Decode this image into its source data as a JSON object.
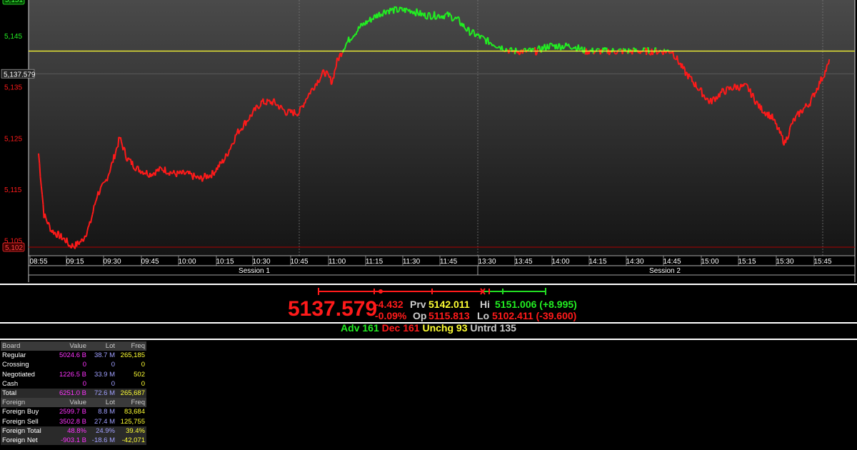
{
  "chart_data": {
    "type": "line",
    "title": "",
    "xlabel": "",
    "ylabel": "",
    "x_tick_labels": [
      "08:55",
      "09:15",
      "09:30",
      "09:45",
      "10:00",
      "10:15",
      "10:30",
      "10:45",
      "11:00",
      "11:15",
      "11:30",
      "11:45",
      "13:30",
      "13:45",
      "14:00",
      "14:15",
      "14:30",
      "14:45",
      "15:00",
      "15:15",
      "15:30",
      "15:45"
    ],
    "y_tick_labels": [
      "5,145",
      "5,135",
      "5,125",
      "5,115",
      "5,105"
    ],
    "ylim": [
      5102,
      5152
    ],
    "sessions": [
      "Session 1",
      "Session 2"
    ],
    "reference_line": 5142.011,
    "current_value_label": "5,137.579",
    "low_value_label": "5,102",
    "top_value_label": "5,151",
    "series": [
      {
        "x": [
          "08:55",
          "08:58",
          "09:02",
          "09:06",
          "09:10",
          "09:12",
          "09:15",
          "09:18",
          "09:21",
          "09:24",
          "09:27",
          "09:30",
          "09:33",
          "09:36",
          "09:40",
          "09:45",
          "09:50",
          "09:55",
          "10:00",
          "10:05",
          "10:10",
          "10:15",
          "10:20",
          "10:25",
          "10:30",
          "10:35",
          "10:40",
          "10:45",
          "10:48",
          "10:52",
          "10:55",
          "10:58",
          "11:00",
          "11:03",
          "11:06",
          "11:10",
          "11:13",
          "11:16",
          "11:20",
          "11:25",
          "11:30",
          "11:35",
          "11:40",
          "11:45",
          "11:50",
          "11:55",
          "13:30",
          "13:35",
          "13:40",
          "13:45",
          "13:50",
          "13:55",
          "14:00",
          "14:05",
          "14:10",
          "14:15",
          "14:20",
          "14:25",
          "14:30",
          "14:35",
          "14:40",
          "14:45",
          "14:50",
          "14:55",
          "15:00",
          "15:05",
          "15:10",
          "15:15",
          "15:20",
          "15:25",
          "15:28",
          "15:30",
          "15:33",
          "15:36",
          "15:40",
          "15:43",
          "15:46",
          "15:48"
        ],
        "values": [
          5122,
          5110,
          5107,
          5106,
          5105,
          5104,
          5104,
          5105,
          5108,
          5114,
          5116,
          5120,
          5125,
          5121,
          5119,
          5118,
          5119,
          5118,
          5118,
          5117,
          5118,
          5121,
          5126,
          5129,
          5132,
          5132,
          5130,
          5130,
          5133,
          5136,
          5138,
          5136,
          5140,
          5143,
          5145,
          5147,
          5148,
          5149,
          5150,
          5150,
          5150,
          5149,
          5149,
          5149,
          5148,
          5146,
          5144,
          5143,
          5142,
          5142,
          5142,
          5143,
          5143,
          5143,
          5142,
          5142,
          5142,
          5142,
          5142,
          5142,
          5142,
          5142,
          5138,
          5135,
          5132,
          5134,
          5135,
          5135,
          5131,
          5129,
          5126,
          5124,
          5128,
          5130,
          5132,
          5135,
          5138,
          5140
        ]
      }
    ]
  },
  "summary": {
    "range_bar_colors": {
      "down": "#ff1a1a",
      "up": "#22dd22"
    },
    "last": "5137.579",
    "change": "-4.432",
    "change_pct": "-0.09%",
    "prv_label": "Prv",
    "prv": "5142.011",
    "op_label": "Op",
    "op": "5115.813",
    "hi_label": "Hi",
    "hi": "5151.006 (+8.995)",
    "lo_label": "Lo",
    "lo": "5102.411 (-39.600)"
  },
  "breadth": {
    "adv": "Adv 161",
    "dec": "Dec 161",
    "unchg": "Unchg 93",
    "untrd": "Untrd 135"
  },
  "board": {
    "header": [
      "Board",
      "Value",
      "Lot",
      "Freq"
    ],
    "rows": [
      [
        "Regular",
        "5024.6 B",
        "38.7 M",
        "265,185"
      ],
      [
        "Crossing",
        "0",
        "0",
        "0"
      ],
      [
        "Negotiated",
        "1226.5 B",
        "33.9 M",
        "502"
      ],
      [
        "Cash",
        "0",
        "0",
        "0"
      ]
    ],
    "total": [
      "Total",
      "6251.0 B",
      "72.6 M",
      "265,687"
    ],
    "foreign_header": [
      "Foreign",
      "Value",
      "Lot",
      "Freq"
    ],
    "foreign_rows": [
      [
        "Foreign Buy",
        "2599.7 B",
        "8.8 M",
        "83,684"
      ],
      [
        "Foreign Sell",
        "3502.8 B",
        "27.4 M",
        "125,755"
      ],
      [
        "Foreign Total",
        "48.8%",
        "24.9%",
        "39.4%"
      ],
      [
        "Foreign Net",
        "-903.1 B",
        "-18.6 M",
        "-42,071"
      ]
    ]
  },
  "colors": {
    "up": "#22ee22",
    "down": "#ff1a1a",
    "reference": "#ffff33",
    "value": "#ff33ff",
    "lot": "#a0a0ff",
    "freq": "#ffff33"
  }
}
